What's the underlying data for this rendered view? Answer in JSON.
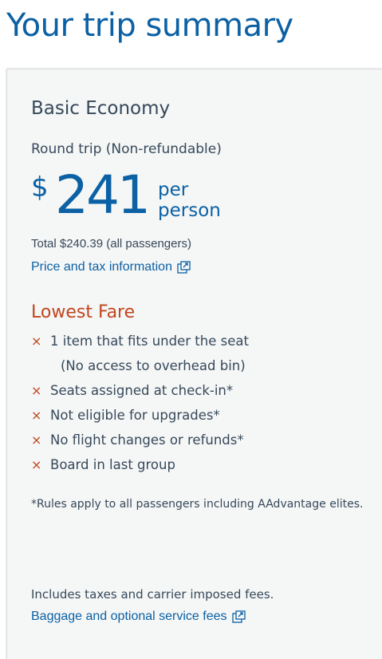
{
  "page": {
    "title": "Your trip summary"
  },
  "fare": {
    "name": "Basic Economy",
    "trip_type": "Round trip (Non-refundable)",
    "currency_symbol": "$",
    "amount": "241",
    "per_unit_line1": "per",
    "per_unit_line2": "person",
    "total": "Total $240.39 (all passengers)",
    "price_link": "Price and tax information",
    "fare_label": "Lowest Fare",
    "restrictions": [
      {
        "line1": "1 item that fits under the seat",
        "line2": "(No access to overhead bin)"
      },
      {
        "line1": "Seats assigned at check-in*"
      },
      {
        "line1": "Not eligible for upgrades*"
      },
      {
        "line1": "No flight changes or refunds*"
      },
      {
        "line1": "Board in last group"
      }
    ],
    "restriction_mark": "×",
    "rules_note": "*Rules apply to all passengers including AAdvantage elites.",
    "includes_text": "Includes taxes and carrier imposed fees.",
    "baggage_link": "Baggage and optional service fees"
  },
  "colors": {
    "title_blue": "#0b61a4",
    "body_text": "#36495a",
    "fare_orange": "#c0461f",
    "card_background": "#f5f6f6"
  },
  "icons": {
    "external_link": "external-link-icon",
    "restriction": "x-mark-icon"
  }
}
